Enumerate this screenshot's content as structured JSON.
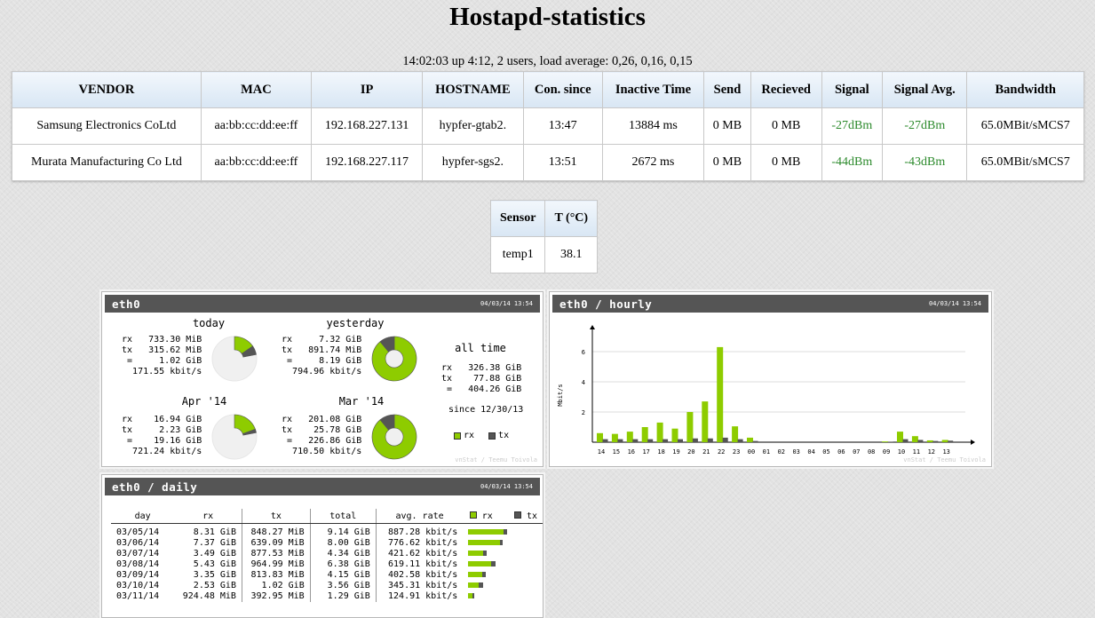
{
  "title": "Hostapd-statistics",
  "uptime": "14:02:03 up 4:12, 2 users, load average: 0,26, 0,16, 0,15",
  "stations": {
    "headers": [
      "VENDOR",
      "MAC",
      "IP",
      "HOSTNAME",
      "Con. since",
      "Inactive Time",
      "Send",
      "Recieved",
      "Signal",
      "Signal Avg.",
      "Bandwidth"
    ],
    "rows": [
      [
        "Samsung Electronics CoLtd",
        "aa:bb:cc:dd:ee:ff",
        "192.168.227.131",
        "hypfer-gtab2.",
        "13:47",
        "13884 ms",
        "0 MB",
        "0 MB",
        "-27dBm",
        "-27dBm",
        "65.0MBit/sMCS7"
      ],
      [
        "Murata Manufacturing Co Ltd",
        "aa:bb:cc:dd:ee:ff",
        "192.168.227.117",
        "hypfer-sgs2.",
        "13:51",
        "2672 ms",
        "0 MB",
        "0 MB",
        "-44dBm",
        "-43dBm",
        "65.0MBit/sMCS7"
      ]
    ]
  },
  "sensors": {
    "headers": [
      "Sensor",
      "T (°C)"
    ],
    "rows": [
      [
        "temp1",
        "38.1"
      ]
    ]
  },
  "colors": {
    "rx": "#8ecc00",
    "tx": "#555555",
    "signal": "#2c8a2c",
    "header_bg": "#555555"
  },
  "summary": {
    "title": "eth0",
    "date": "04/03/14 13:54",
    "credit": "vnStat / Teemu Toivola",
    "today": {
      "label": "today",
      "rx": "733.30 MiB",
      "tx": "315.62 MiB",
      "total": "1.02 GiB",
      "rate": "171.55 kbit/s",
      "rx_share": 0.7
    },
    "yesterday": {
      "label": "yesterday",
      "rx": "7.32 GiB",
      "tx": "891.74 MiB",
      "total": "8.19 GiB",
      "rate": "794.96 kbit/s",
      "rx_share": 0.89
    },
    "month": {
      "label": "Apr '14",
      "rx": "16.94 GiB",
      "tx": "2.23 GiB",
      "total": "19.16 GiB",
      "rate": "721.24 kbit/s",
      "rx_share": 0.88
    },
    "prev_month": {
      "label": "Mar '14",
      "rx": "201.08 GiB",
      "tx": "25.78 GiB",
      "total": "226.86 GiB",
      "rate": "710.50 kbit/s",
      "rx_share": 0.89
    },
    "all_time": {
      "label": "all time",
      "rx": "326.38 GiB",
      "tx": "77.88 GiB",
      "total": "404.26 GiB",
      "since": "since 12/30/13"
    },
    "legend_rx": "rx",
    "legend_tx": "tx"
  },
  "hourly": {
    "title": "eth0 / hourly",
    "date": "04/03/14 13:54",
    "credit": "vnStat / Teemu Toivola"
  },
  "chart_data": {
    "type": "bar",
    "ylabel": "Mbit/s",
    "ylim": [
      0,
      7
    ],
    "yticks": [
      2,
      4,
      6
    ],
    "categories": [
      "14",
      "15",
      "16",
      "17",
      "18",
      "19",
      "20",
      "21",
      "22",
      "23",
      "00",
      "01",
      "02",
      "03",
      "04",
      "05",
      "06",
      "07",
      "08",
      "09",
      "10",
      "11",
      "12",
      "13"
    ],
    "series": [
      {
        "name": "rx",
        "values": [
          0.6,
          0.55,
          0.7,
          1.0,
          1.3,
          0.9,
          2.0,
          2.7,
          6.3,
          1.05,
          0.3,
          0,
          0,
          0,
          0,
          0,
          0,
          0,
          0,
          0.05,
          0.7,
          0.4,
          0.12,
          0.15
        ]
      },
      {
        "name": "tx",
        "values": [
          0.2,
          0.2,
          0.2,
          0.2,
          0.2,
          0.2,
          0.25,
          0.25,
          0.3,
          0.2,
          0.08,
          0,
          0,
          0,
          0,
          0,
          0,
          0,
          0,
          0.02,
          0.2,
          0.15,
          0.08,
          0.1
        ]
      }
    ]
  },
  "daily": {
    "title": "eth0 / daily",
    "date": "04/03/14 13:54",
    "headers": [
      "day",
      "rx",
      "tx",
      "total",
      "avg. rate"
    ],
    "legend_rx": "rx",
    "legend_tx": "tx",
    "rows": [
      {
        "day": "03/05/14",
        "rx": "8.31 GiB",
        "tx": "848.27 MiB",
        "total": "9.14 GiB",
        "rate": "887.28 kbit/s",
        "rate_kbit": 887.28,
        "rx_share": 0.91
      },
      {
        "day": "03/06/14",
        "rx": "7.37 GiB",
        "tx": "639.09 MiB",
        "total": "8.00 GiB",
        "rate": "776.62 kbit/s",
        "rate_kbit": 776.62,
        "rx_share": 0.92
      },
      {
        "day": "03/07/14",
        "rx": "3.49 GiB",
        "tx": "877.53 MiB",
        "total": "4.34 GiB",
        "rate": "421.62 kbit/s",
        "rate_kbit": 421.62,
        "rx_share": 0.8
      },
      {
        "day": "03/08/14",
        "rx": "5.43 GiB",
        "tx": "964.99 MiB",
        "total": "6.38 GiB",
        "rate": "619.11 kbit/s",
        "rate_kbit": 619.11,
        "rx_share": 0.85
      },
      {
        "day": "03/09/14",
        "rx": "3.35 GiB",
        "tx": "813.83 MiB",
        "total": "4.15 GiB",
        "rate": "402.58 kbit/s",
        "rate_kbit": 402.58,
        "rx_share": 0.81
      },
      {
        "day": "03/10/14",
        "rx": "2.53 GiB",
        "tx": "1.02 GiB",
        "total": "3.56 GiB",
        "rate": "345.31 kbit/s",
        "rate_kbit": 345.31,
        "rx_share": 0.71
      },
      {
        "day": "03/11/14",
        "rx": "924.48 MiB",
        "tx": "392.95 MiB",
        "total": "1.29 GiB",
        "rate": "124.91 kbit/s",
        "rate_kbit": 124.91,
        "rx_share": 0.7
      }
    ]
  }
}
